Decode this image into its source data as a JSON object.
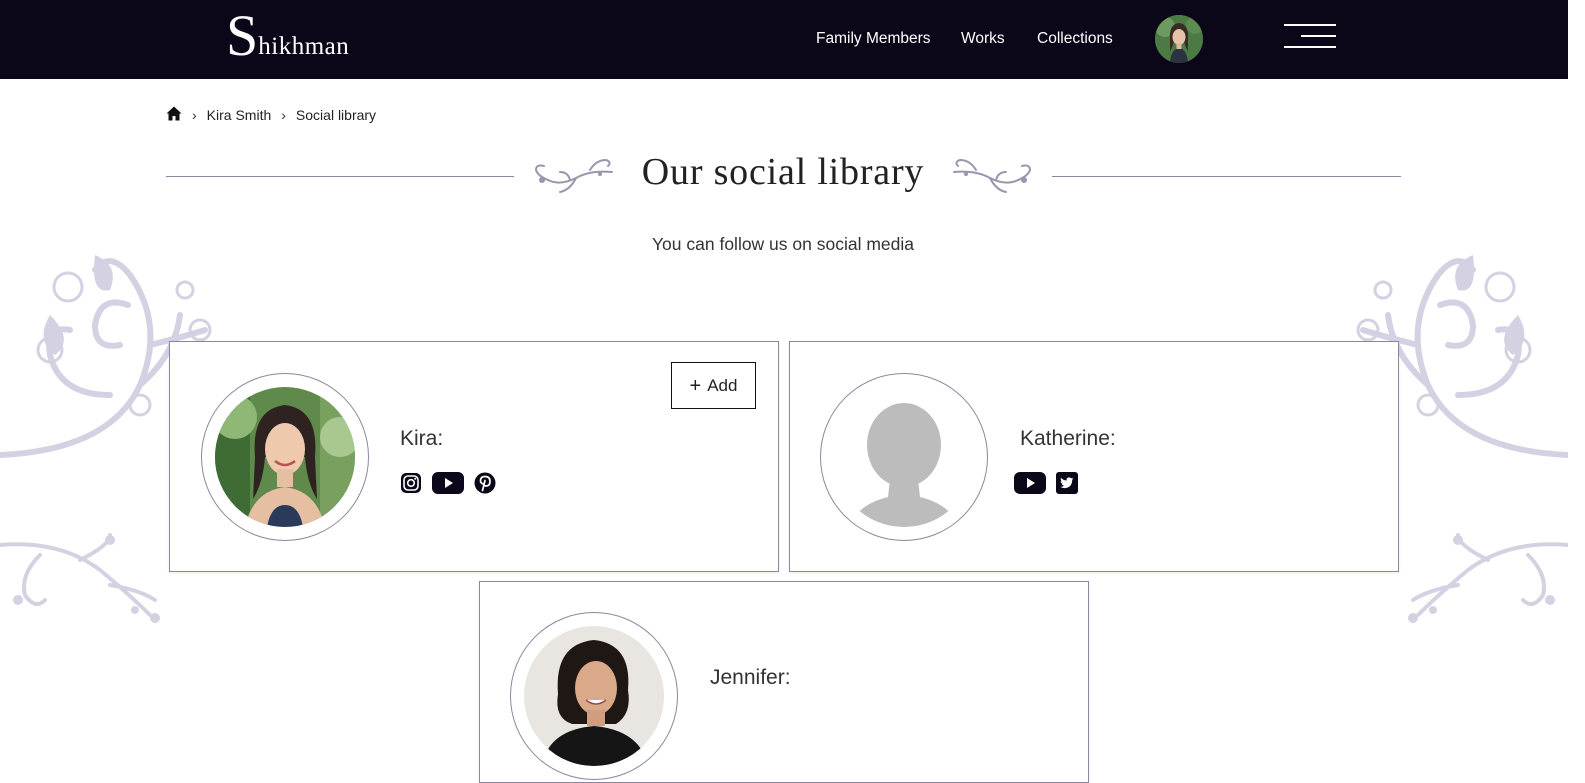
{
  "header": {
    "logo_initial": "S",
    "logo_rest": "hikhman",
    "nav": [
      {
        "label": "Family Members"
      },
      {
        "label": "Works"
      },
      {
        "label": "Collections"
      }
    ]
  },
  "breadcrumb": {
    "items": [
      "Kira Smith",
      "Social library"
    ]
  },
  "page": {
    "title": "Our social library",
    "subtitle": "You can follow us on social media"
  },
  "cards": [
    {
      "name": "Kira:",
      "socials": [
        "instagram-icon",
        "youtube-icon",
        "pinterest-icon"
      ],
      "add_label": "Add"
    },
    {
      "name": "Katherine:",
      "socials": [
        "youtube-icon",
        "twitter-icon"
      ]
    },
    {
      "name": "Jennifer:",
      "socials": []
    }
  ],
  "colors": {
    "header_bg": "#0b0718",
    "accent_line": "#8a87a0",
    "ornament": "#d4d2e2"
  }
}
